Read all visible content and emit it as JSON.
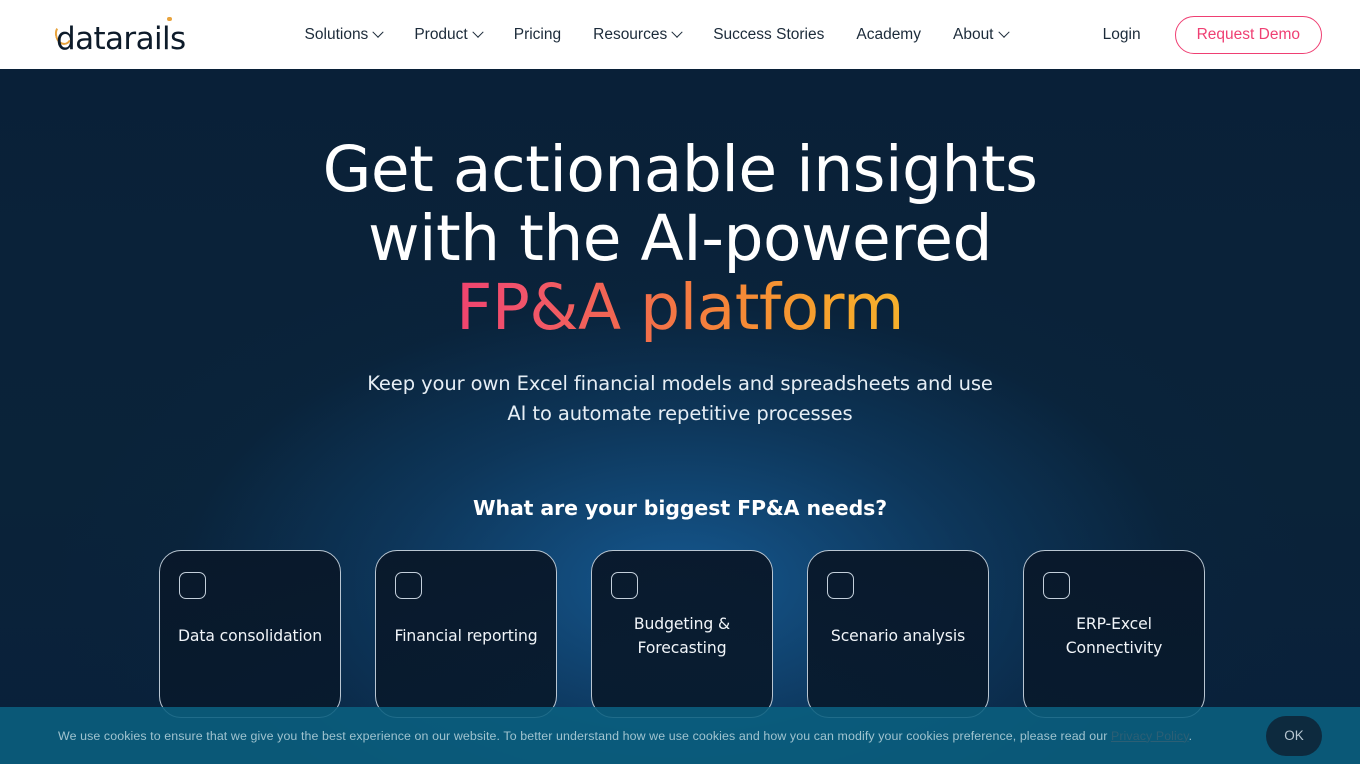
{
  "brand": {
    "logo_text": "datarails",
    "accent_pink": "#ef3f73",
    "accent_gold": "#e8a33d",
    "hero_bg": "#0a2239"
  },
  "header": {
    "nav": [
      {
        "label": "Solutions",
        "has_dropdown": true
      },
      {
        "label": "Product",
        "has_dropdown": true
      },
      {
        "label": "Pricing",
        "has_dropdown": false
      },
      {
        "label": "Resources",
        "has_dropdown": true
      },
      {
        "label": "Success Stories",
        "has_dropdown": false
      },
      {
        "label": "Academy",
        "has_dropdown": false
      },
      {
        "label": "About",
        "has_dropdown": true
      }
    ],
    "login_label": "Login",
    "demo_label": "Request Demo"
  },
  "hero": {
    "headline_line1": "Get actionable insights",
    "headline_line2": "with the AI-powered",
    "headline_line3_gradient": "FP&A platform",
    "subhead_line1": "Keep your own Excel financial models and spreadsheets and use",
    "subhead_line2": "AI to automate repetitive processes",
    "needs_title": "What are your biggest FP&A needs?",
    "cards": [
      {
        "label": "Data consolidation",
        "checked": false
      },
      {
        "label": "Financial reporting",
        "checked": false
      },
      {
        "label": "Budgeting & Forecasting",
        "checked": false
      },
      {
        "label": "Scenario analysis",
        "checked": false
      },
      {
        "label": "ERP-Excel Connectivity",
        "checked": false
      }
    ]
  },
  "cookie": {
    "text_before_link": "We use cookies to ensure that we give you the best experience on our website. To better understand how we use cookies and how you can modify your cookies preference, please read our ",
    "link_label": "Privacy Policy",
    "text_after_link": ".",
    "ok_label": "OK"
  }
}
